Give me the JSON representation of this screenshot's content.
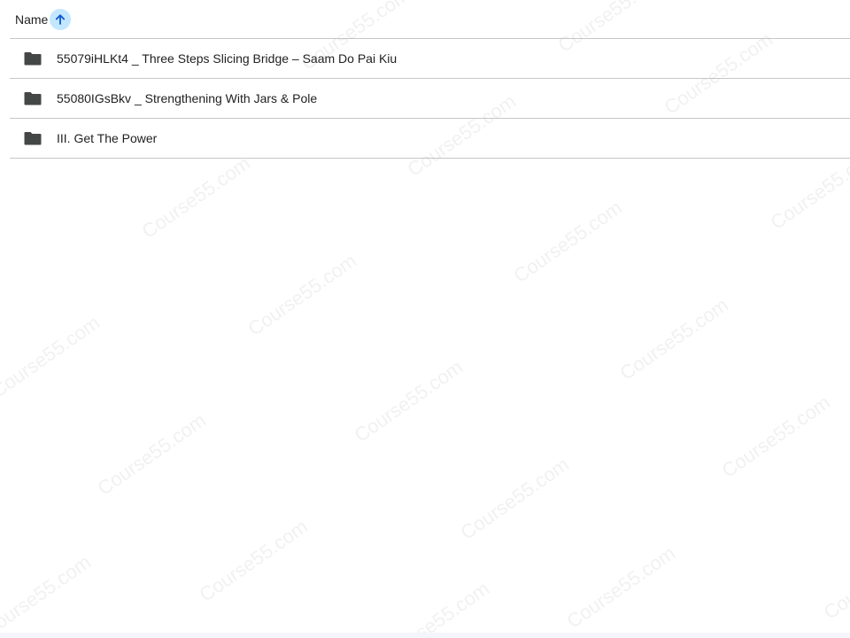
{
  "header": {
    "name_label": "Name",
    "sort_icon": "arrow-up-icon"
  },
  "rows": [
    {
      "label": "55079iHLKt4 _ Three Steps Slicing Bridge – Saam Do Pai Kiu",
      "icon": "folder-icon"
    },
    {
      "label": "55080IGsBkv _ Strengthening With Jars & Pole",
      "icon": "folder-icon"
    },
    {
      "label": "III. Get The Power",
      "icon": "folder-icon"
    }
  ],
  "watermark_text": "Course55.com"
}
